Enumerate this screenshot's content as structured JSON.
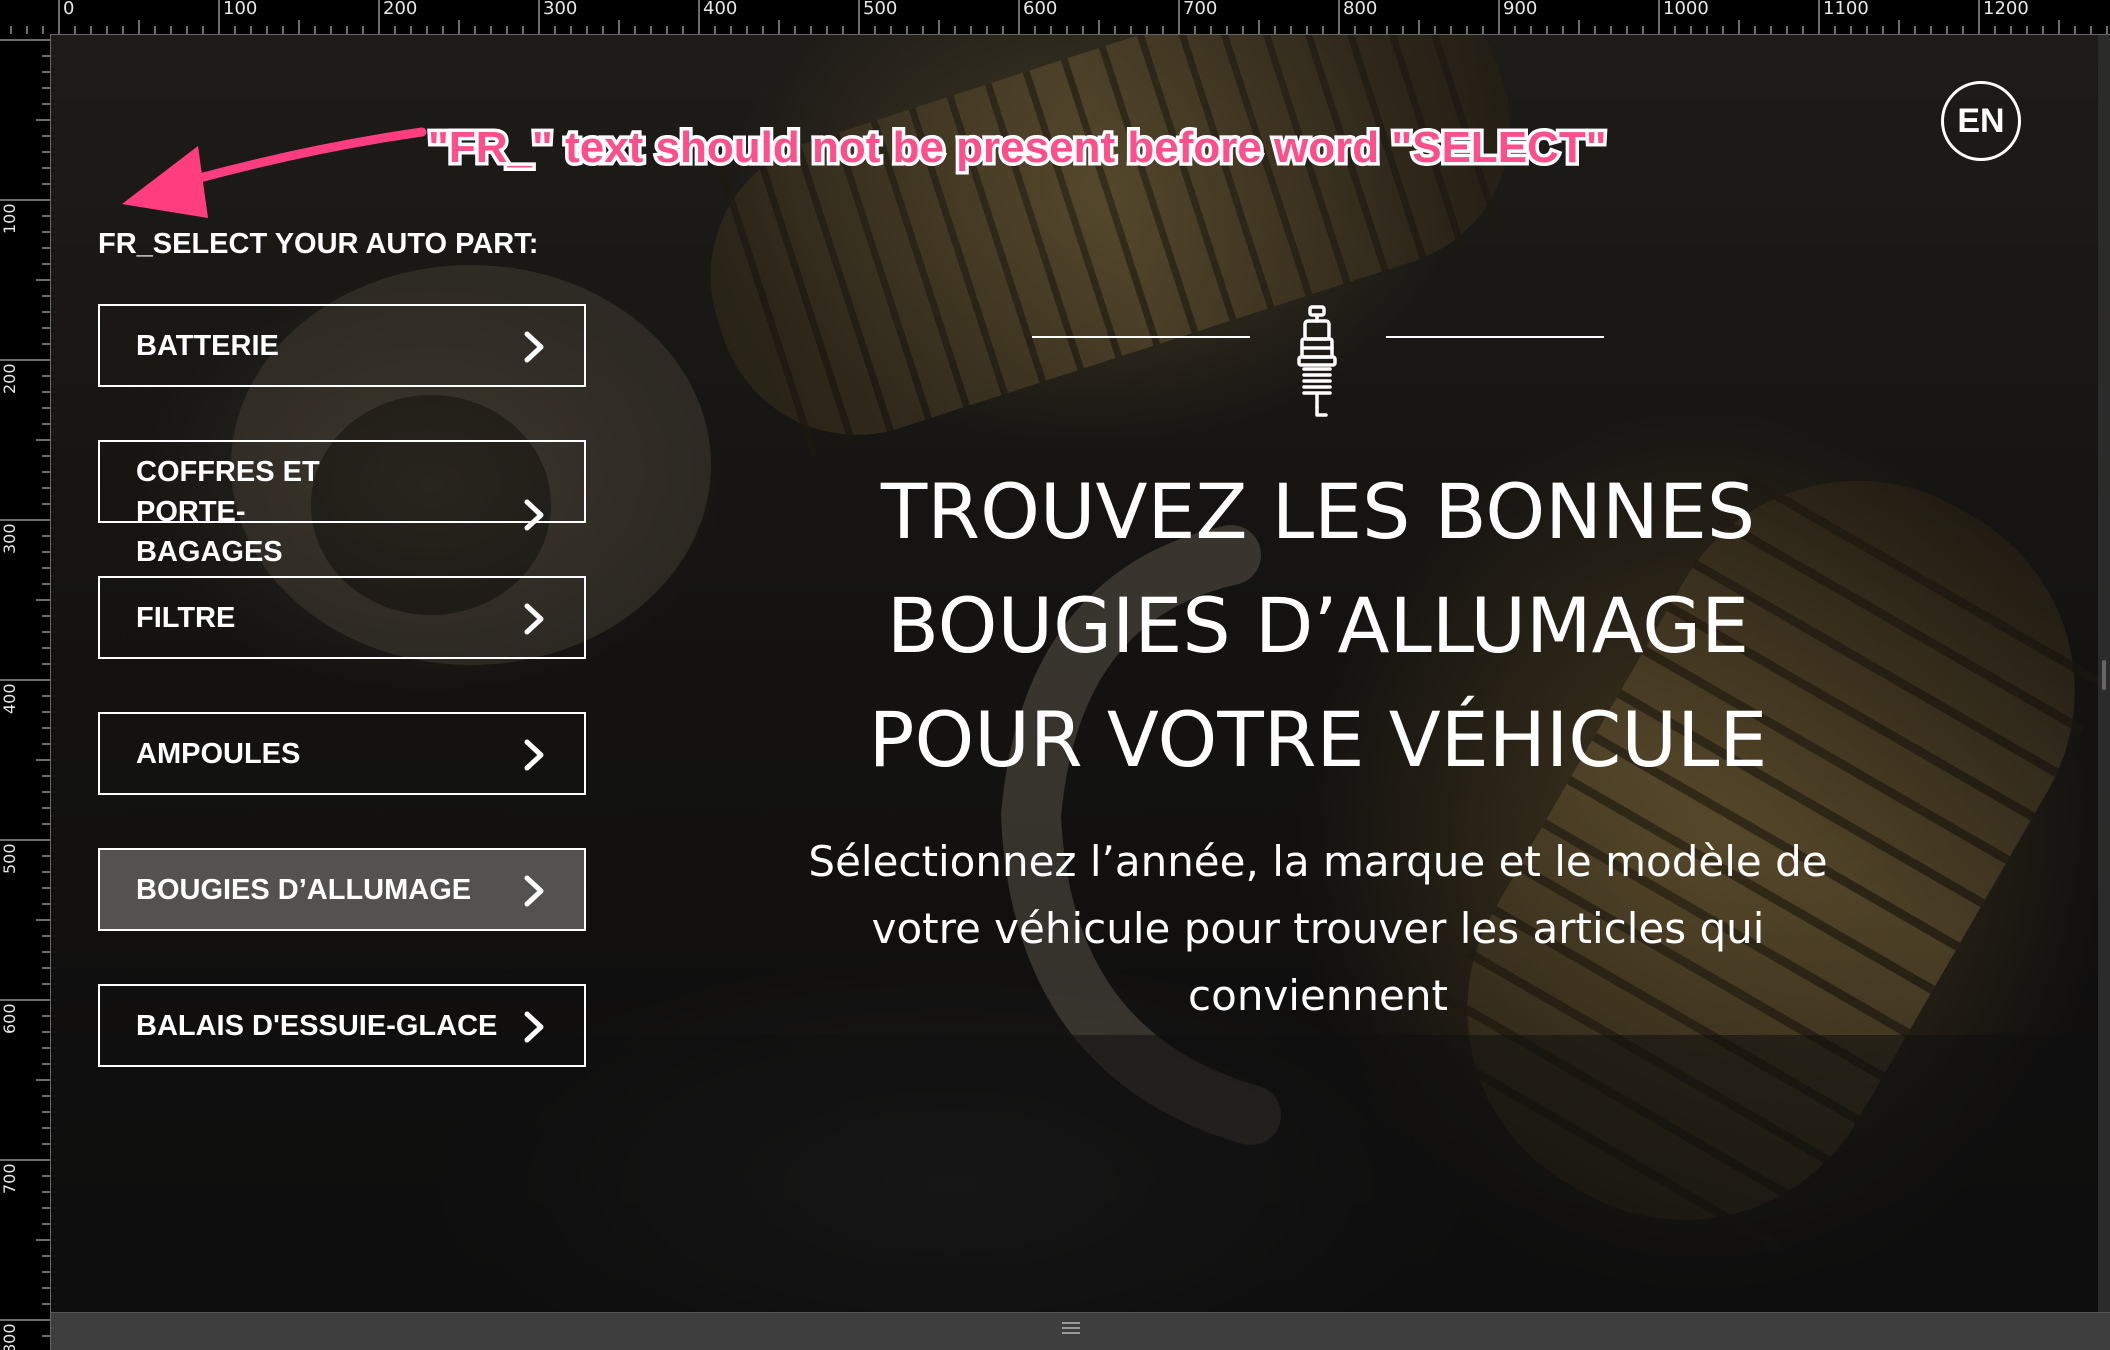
{
  "ruler": {
    "top_labels": [
      "0",
      "100",
      "200",
      "300",
      "400",
      "500",
      "600",
      "700",
      "800",
      "900",
      "1000",
      "1100",
      "1200"
    ],
    "left_labels": [
      "100",
      "200",
      "300",
      "400",
      "500",
      "600",
      "700",
      "800"
    ]
  },
  "annotation": {
    "text": "\"FR_\" text should not be present before word \"SELECT\"",
    "color": "#ff4f8b"
  },
  "language_button": {
    "label": "EN"
  },
  "sidebar": {
    "heading": "FR_SELECT YOUR AUTO PART:",
    "items": [
      {
        "label": "BATTERIE",
        "active": false
      },
      {
        "label": "COFFRES ET PORTE-BAGAGES",
        "line1": "COFFRES ET PORTE-",
        "line2": "BAGAGES",
        "active": false
      },
      {
        "label": "FILTRE",
        "active": false
      },
      {
        "label": "AMPOULES",
        "active": false
      },
      {
        "label": "BOUGIES D’ALLUMAGE",
        "active": true
      },
      {
        "label": "BALAIS D'ESSUIE-GLACE",
        "active": false
      }
    ]
  },
  "hero": {
    "title_lines": [
      "TROUVEZ LES BONNES",
      "BOUGIES D’ALLUMAGE",
      "POUR VOTRE VÉHICULE"
    ],
    "subtitle_lines": [
      "Sélectionnez l’année, la marque et le modèle de",
      "votre véhicule pour trouver les articles qui",
      "conviennent"
    ],
    "icon": "spark-plug-icon"
  },
  "colors": {
    "text": "#ffffff",
    "ruler_bg": "#000000",
    "editor_bg": "#3a3a3a",
    "active_button_bg": "rgba(255,255,255,0.28)"
  }
}
